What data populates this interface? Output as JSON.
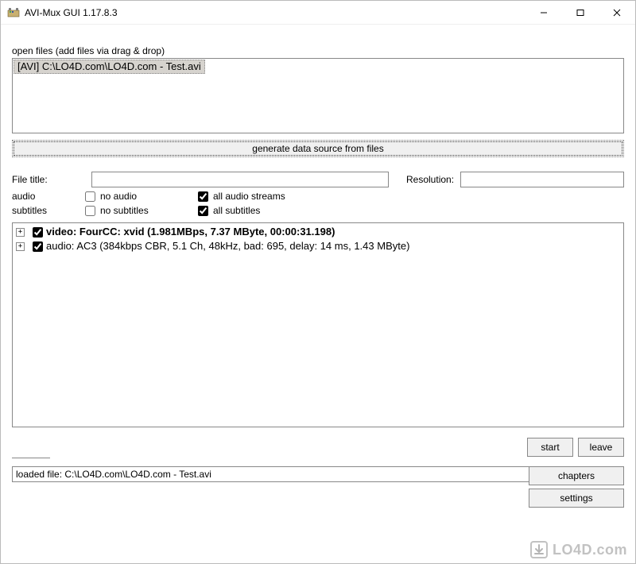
{
  "window": {
    "title": "AVI-Mux GUI 1.17.8.3"
  },
  "openFiles": {
    "label": "open files (add files via drag & drop)",
    "items": [
      {
        "prefix": "[AVI]",
        "path": "C:\\LO4D.com\\LO4D.com - Test.avi"
      }
    ]
  },
  "buttons": {
    "generate": "generate data source from files",
    "chapters": "chapters",
    "settings": "settings",
    "start": "start",
    "leave": "leave"
  },
  "labels": {
    "fileTitle": "File title:",
    "resolution": "Resolution:",
    "audio": "audio",
    "subtitles": "subtitles",
    "noAudio": "no audio",
    "allAudioStreams": "all audio streams",
    "noSubtitles": "no subtitles",
    "allSubtitles": "all subtitles"
  },
  "inputs": {
    "fileTitle": "",
    "resolution": ""
  },
  "checkboxes": {
    "noAudio": false,
    "allAudioStreams": true,
    "noSubtitles": false,
    "allSubtitles": true
  },
  "tree": {
    "video": {
      "checked": true,
      "text": "video: FourCC: xvid (1.981MBps, 7.37 MByte, 00:00:31.198)"
    },
    "audio": {
      "checked": true,
      "text": "audio: AC3 (384kbps CBR, 5.1 Ch, 48kHz, bad: 695, delay: 14 ms, 1.43 MByte)"
    }
  },
  "status": {
    "text": "loaded file: C:\\LO4D.com\\LO4D.com - Test.avi"
  },
  "watermark": {
    "text": "LO4D.com"
  }
}
